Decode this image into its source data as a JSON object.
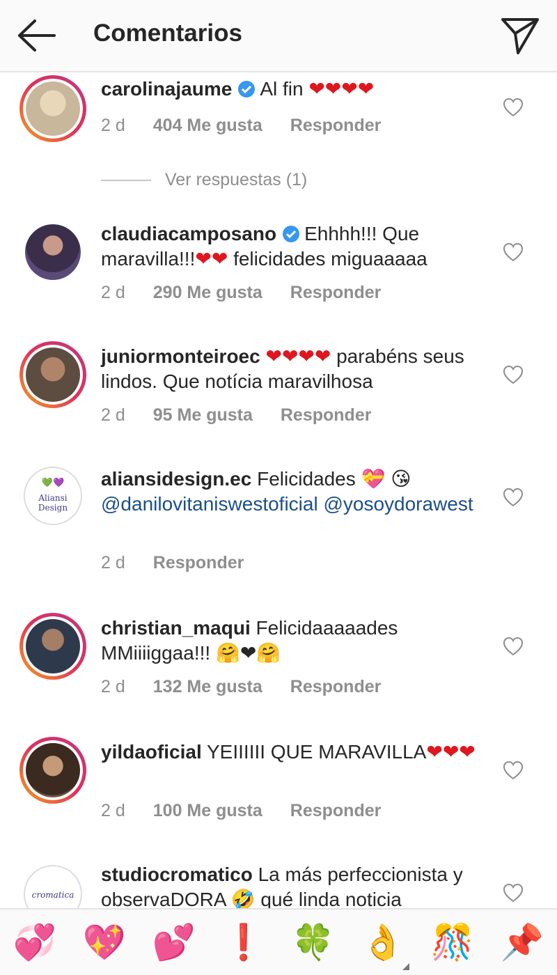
{
  "header": {
    "title": "Comentarios"
  },
  "comments": [
    {
      "username": "carolinajaume",
      "verified": true,
      "body": "Al fin",
      "hearts": "❤❤❤❤",
      "time": "2 d",
      "likes": "404 Me gusta",
      "reply": "Responder",
      "view_replies": "Ver respuestas (1)",
      "avatar_color": "#c9b79c"
    },
    {
      "username": "claudiacamposano",
      "verified": true,
      "body_part1": "Ehhhh!!! Que maravilla!!!",
      "hearts": "❤❤",
      "body_part2": "felicidades miguaaaaa",
      "time": "2 d",
      "likes": "290 Me gusta",
      "reply": "Responder",
      "avatar_color": "#5a4a78"
    },
    {
      "username": "juniormonteiroec",
      "hearts": "❤❤❤❤",
      "body": "parabéns seus lindos. Que notícia maravilhosa",
      "time": "2 d",
      "likes": "95 Me gusta",
      "reply": "Responder",
      "avatar_color": "#7a6252"
    },
    {
      "username": "aliansidesign.ec",
      "body": "Felicidades",
      "gift_emoji": "💝",
      "kiss_emoji": "😘",
      "mention1": "@danilovitaniswestoficial",
      "mention2": "@yosoydorawest",
      "time": "2 d",
      "reply": "Responder",
      "brand": "Aliansi Design",
      "brand_hearts": "💚💜"
    },
    {
      "username": "christian_maqui",
      "body": "Felicidaaaaades MMiiiiggaa!!!",
      "emojis": "🤗❤🤗",
      "time": "2 d",
      "likes": "132 Me gusta",
      "reply": "Responder",
      "avatar_color": "#3b4a5e"
    },
    {
      "username": "yildaoficial",
      "body": "YEIIIIII QUE MARAVILLA",
      "hearts": "❤❤❤",
      "time": "2 d",
      "likes": "100 Me gusta",
      "reply": "Responder",
      "avatar_color": "#6b5442"
    },
    {
      "username": "studiocromatico",
      "body": "La más perfeccionista y observaDORA",
      "laugh_emoji": "🤣",
      "body2": "qué linda noticia",
      "brand": "cromatica"
    }
  ],
  "emoji_tray": [
    "💞",
    "💖",
    "💕",
    "❗",
    "🍀",
    "👌",
    "🎊",
    "📌"
  ],
  "colors": {
    "accent_blue": "#3897f0",
    "heart_red": "#e0161f",
    "meta_gray": "#8e8e8e"
  }
}
